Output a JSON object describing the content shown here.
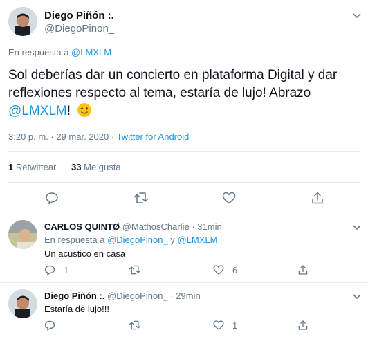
{
  "main_tweet": {
    "author_name": "Diego Piñón :.",
    "author_handle": "@DiegoPinon_",
    "reply_prefix": "En respuesta a ",
    "reply_to": "@LMXLM",
    "text_main": "Sol deberías dar un concierto en plataforma Digital y dar reflexiones respecto al tema, estaría de lujo! Abrazo ",
    "text_mention": "@LMXLM",
    "text_after": "!",
    "emoji": "😉",
    "timestamp": "3:20 p. m. · 29 mar. 2020 · ",
    "source": "Twitter for Android",
    "retweets_count": "1",
    "retweets_label": "Retwittear",
    "likes_count": "33",
    "likes_label": "Me gusta"
  },
  "replies": [
    {
      "author_name": "CARLOS QUINTØ",
      "author_handle": "@MathosCharlie",
      "time": "31min",
      "reply_prefix": "En respuesta a ",
      "reply_to_1": "@DiegoPinon_",
      "reply_join": " y ",
      "reply_to_2": "@LMXLM",
      "text": "Un acústico en casa",
      "reply_count": "1",
      "like_count": "6"
    },
    {
      "author_name": "Diego Piñón :.",
      "author_handle": "@DiegoPinon_",
      "time": "29min",
      "text": "Estaría de lujo!!!",
      "like_count": "1"
    }
  ],
  "separator": "·",
  "icons": [
    "chevron-down-icon",
    "reply-icon",
    "retweet-icon",
    "like-icon",
    "share-icon"
  ]
}
